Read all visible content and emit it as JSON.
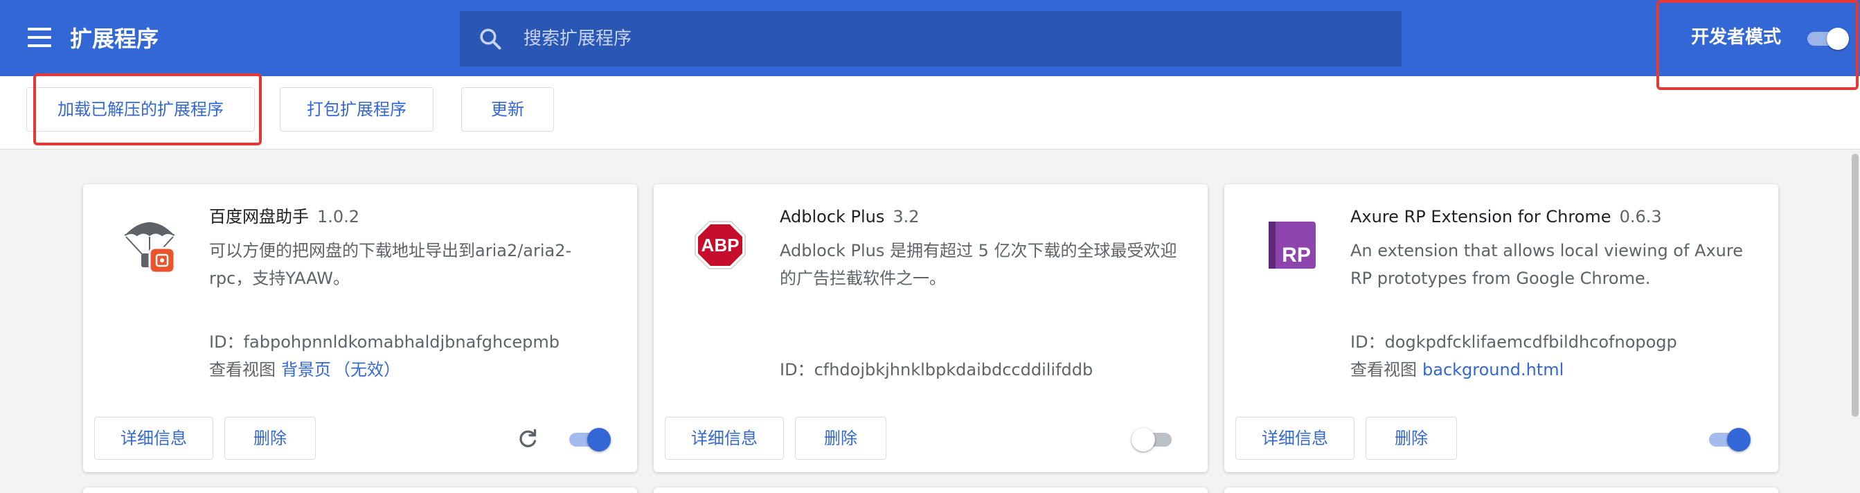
{
  "header": {
    "title": "扩展程序",
    "search_placeholder": "搜索扩展程序",
    "dev_mode_label": "开发者模式",
    "dev_mode_on": true,
    "background_color": "#3367d6"
  },
  "toolbar": {
    "load_unpacked": "加载已解压的扩展程序",
    "pack": "打包扩展程序",
    "update": "更新"
  },
  "extensions": [
    {
      "name": "百度网盘助手",
      "version": "1.0.2",
      "description": "可以方便的把网盘的下载地址导出到aria2/aria2-rpc，支持YAAW。",
      "id_label": "ID：",
      "id": "fabpohpnnldkomabhaldjbnafghcepmb",
      "views_label": "查看视图",
      "views_link": "背景页",
      "views_note": "（无效）",
      "details_label": "详细信息",
      "remove_label": "删除",
      "enabled": true,
      "icon": "parachute-icon"
    },
    {
      "name": "Adblock Plus",
      "version": "3.2",
      "description": "Adblock Plus 是拥有超过 5 亿次下载的全球最受欢迎的广告拦截软件之一。",
      "id_label": "ID：",
      "id": "cfhdojbkjhnklbpkdaibdccddilifddb",
      "details_label": "详细信息",
      "remove_label": "删除",
      "enabled": false,
      "icon": "abp-icon"
    },
    {
      "name": "Axure RP Extension for Chrome",
      "version": "0.6.3",
      "description": "An extension that allows local viewing of Axure RP prototypes from Google Chrome.",
      "id_label": "ID：",
      "id": "dogkpdfcklifaemcdfbildhcofnopogp",
      "views_label": "查看视图",
      "views_link": "background.html",
      "details_label": "详细信息",
      "remove_label": "删除",
      "enabled": true,
      "icon": "axure-rp-icon"
    }
  ],
  "colors": {
    "accent": "#3367d6",
    "highlight": "#e53935",
    "abp_red": "#c70d2c",
    "axure_purple": "#8e44ad"
  }
}
